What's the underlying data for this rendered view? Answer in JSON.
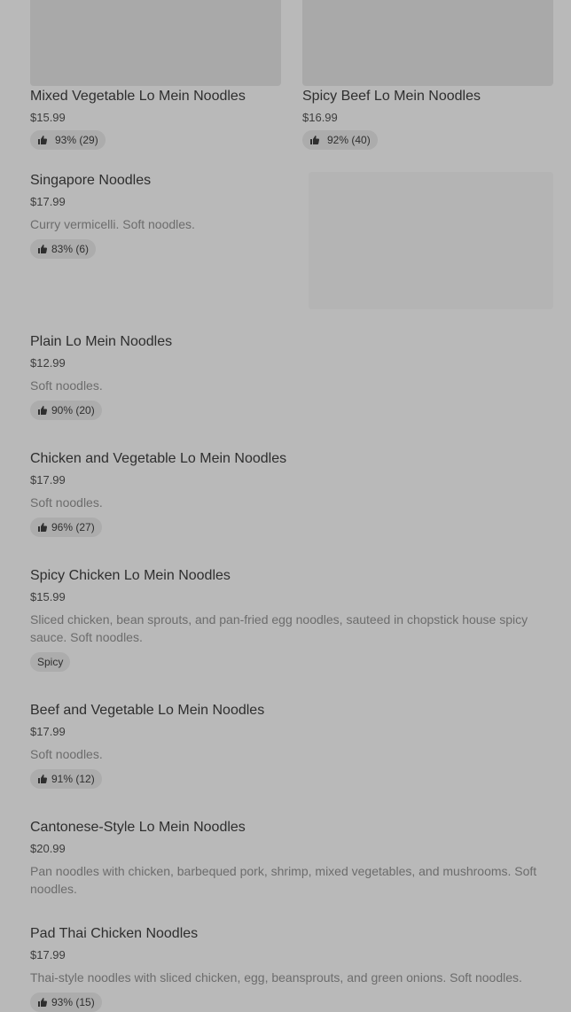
{
  "top_cards": [
    {
      "title": "Mixed Vegetable Lo Mein Noodles",
      "price": "$15.99",
      "rating": "93% (29)"
    },
    {
      "title": "Spicy Beef Lo Mein Noodles",
      "price": "$16.99",
      "rating": "92% (40)"
    }
  ],
  "items": [
    {
      "title": "Singapore Noodles",
      "price": "$17.99",
      "description": "Curry vermicelli. Soft noodles.",
      "rating": "83% (6)"
    },
    {
      "title": "Plain Lo Mein Noodles",
      "price": "$12.99",
      "description": "Soft noodles.",
      "rating": "90% (20)"
    },
    {
      "title": "Chicken and Vegetable Lo Mein Noodles",
      "price": "$17.99",
      "description": "Soft noodles.",
      "rating": "96% (27)"
    },
    {
      "title": "Spicy Chicken Lo Mein Noodles",
      "price": "$15.99",
      "description": "Sliced chicken, bean sprouts, and pan-fried egg noodles, sauteed in chopstick house spicy sauce. Soft noodles.",
      "tag": "Spicy"
    },
    {
      "title": "Beef and Vegetable Lo Mein Noodles",
      "price": "$17.99",
      "description": "Soft noodles.",
      "rating": "91% (12)"
    },
    {
      "title": "Cantonese-Style Lo Mein Noodles",
      "price": "$20.99",
      "description": "Pan noodles with chicken, barbequed pork, shrimp, mixed vegetables, and mushrooms. Soft noodles."
    },
    {
      "title": "Pad Thai Chicken Noodles",
      "price": "$17.99",
      "description": "Thai-style noodles with sliced chicken, egg, beansprouts, and green onions. Soft noodles.",
      "rating": "93% (15)"
    }
  ],
  "icons": {
    "rating": "thumbs-up-icon"
  }
}
